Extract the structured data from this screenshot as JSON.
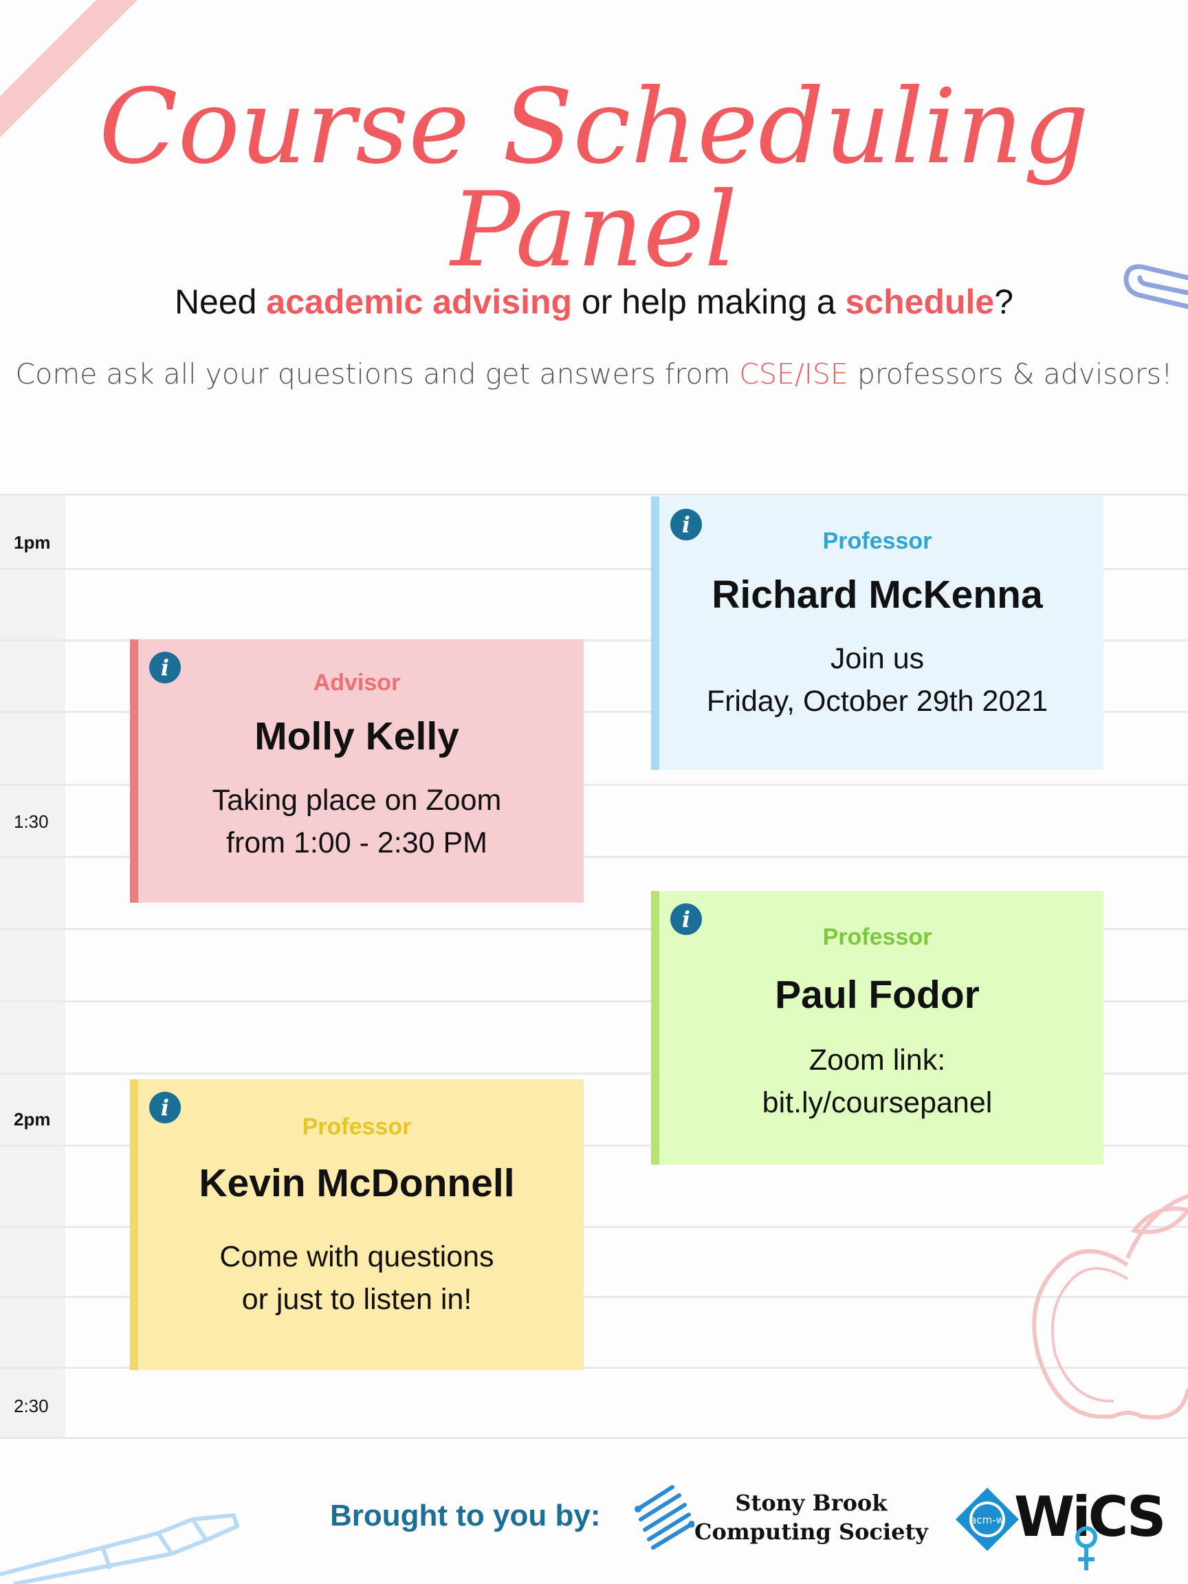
{
  "header": {
    "title": "Course Scheduling Panel",
    "subtitle": {
      "p1": "Need ",
      "h1": "academic advising",
      "p2": " or help making a ",
      "h2": "schedule",
      "p3": "?"
    },
    "tagline": {
      "p1": "Come ask all your questions and get answers from ",
      "h1": "CSE/ISE",
      "p2": " professors & advisors!"
    }
  },
  "timeline": {
    "labels": [
      "1pm",
      "1:30",
      "2pm",
      "2:30"
    ]
  },
  "cards": [
    {
      "role": "Professor",
      "name": "Richard McKenna",
      "line1": "Join us",
      "line2": "Friday, October 29th 2021",
      "accent": "#a6d9f5",
      "bg": "#e8f5fd",
      "role_color": "#2ea5d4"
    },
    {
      "role": "Advisor",
      "name": "Molly Kelly",
      "line1": "Taking place on Zoom",
      "line2": "from 1:00 - 2:30 PM",
      "accent": "#ee7b80",
      "bg": "#f6cdd0",
      "role_color": "#ee6f74"
    },
    {
      "role": "Professor",
      "name": "Paul Fodor",
      "line1": "Zoom link:",
      "line2": "bit.ly/coursepanel",
      "accent": "#b4e36f",
      "bg": "#e1fcc0",
      "role_color": "#7cc83e"
    },
    {
      "role": "Professor",
      "name": "Kevin McDonnell",
      "line1": "Come with questions",
      "line2": "or just to listen in!",
      "accent": "#f3d76a",
      "bg": "#fcebaa",
      "role_color": "#e8c424"
    }
  ],
  "icons": {
    "info": "i"
  },
  "footer": {
    "label": "Brought to you by:",
    "sbcs_line1": "Stony Brook",
    "sbcs_line2": "Computing Society",
    "acm_badge": "acm-w",
    "wics": "WiCS"
  },
  "colors": {
    "brand": "#ef5b5f",
    "info": "#1b6f96"
  }
}
